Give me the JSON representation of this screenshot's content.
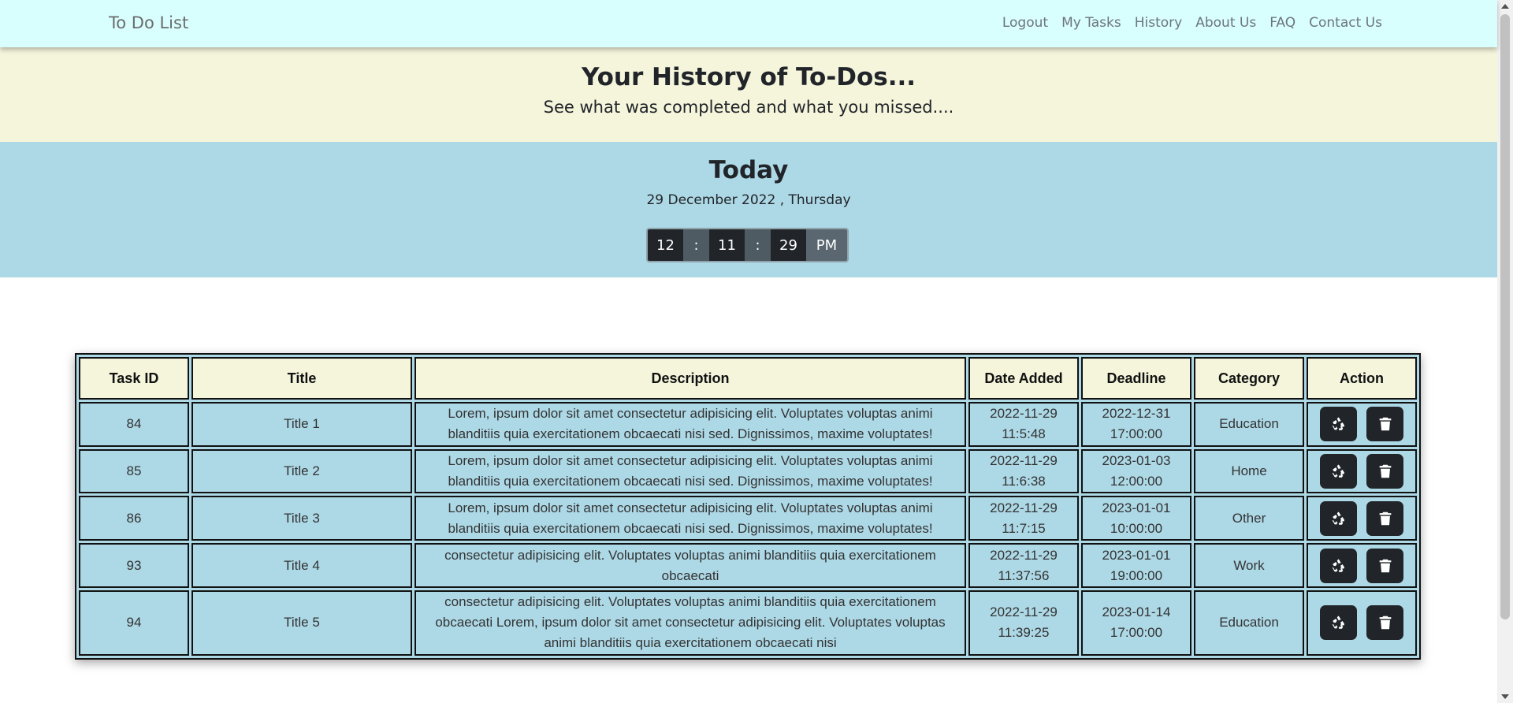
{
  "navbar": {
    "brand": "To Do List",
    "links": [
      "Logout",
      "My Tasks",
      "History",
      "About Us",
      "FAQ",
      "Contact Us"
    ]
  },
  "hero": {
    "title": "Your History of To-Dos...",
    "subtitle": "See what was completed and what you missed...."
  },
  "today": {
    "heading": "Today",
    "date": "29 December 2022 , Thursday",
    "clock": {
      "hours": "12",
      "minutes": "11",
      "seconds": "29",
      "separator": ":",
      "ampm": "PM"
    }
  },
  "table": {
    "headers": [
      "Task ID",
      "Title",
      "Description",
      "Date Added",
      "Deadline",
      "Category",
      "Action"
    ],
    "rows": [
      {
        "id": "84",
        "title": "Title 1",
        "description": "Lorem, ipsum dolor sit amet consectetur adipisicing elit. Voluptates voluptas animi blanditiis quia exercitationem obcaecati nisi sed. Dignissimos, maxime voluptates!",
        "date_added": [
          "2022-11-29",
          "11:5:48"
        ],
        "deadline": [
          "2022-12-31",
          "17:00:00"
        ],
        "category": "Education"
      },
      {
        "id": "85",
        "title": "Title 2",
        "description": "Lorem, ipsum dolor sit amet consectetur adipisicing elit. Voluptates voluptas animi blanditiis quia exercitationem obcaecati nisi sed. Dignissimos, maxime voluptates!",
        "date_added": [
          "2022-11-29",
          "11:6:38"
        ],
        "deadline": [
          "2023-01-03",
          "12:00:00"
        ],
        "category": "Home"
      },
      {
        "id": "86",
        "title": "Title 3",
        "description": "Lorem, ipsum dolor sit amet consectetur adipisicing elit. Voluptates voluptas animi blanditiis quia exercitationem obcaecati nisi sed. Dignissimos, maxime voluptates!",
        "date_added": [
          "2022-11-29",
          "11:7:15"
        ],
        "deadline": [
          "2023-01-01",
          "10:00:00"
        ],
        "category": "Other"
      },
      {
        "id": "93",
        "title": "Title 4",
        "description": "consectetur adipisicing elit. Voluptates voluptas animi blanditiis quia exercitationem obcaecati",
        "date_added": [
          "2022-11-29",
          "11:37:56"
        ],
        "deadline": [
          "2023-01-01",
          "19:00:00"
        ],
        "category": "Work"
      },
      {
        "id": "94",
        "title": "Title 5",
        "description": "consectetur adipisicing elit. Voluptates voluptas animi blanditiis quia exercitationem obcaecati Lorem, ipsum dolor sit amet consectetur adipisicing elit. Voluptates voluptas animi blanditiis quia exercitationem obcaecati nisi",
        "date_added": [
          "2022-11-29",
          "11:39:25"
        ],
        "deadline": [
          "2023-01-14",
          "17:00:00"
        ],
        "category": "Education"
      }
    ],
    "actions": {
      "restore_icon": "recycle-icon",
      "delete_icon": "trash-icon"
    }
  },
  "colors": {
    "navbar_bg": "#d9fefe",
    "hero_bg": "#f5f5dc",
    "today_bg": "#add8e6",
    "table_header_bg": "#f5f5dc",
    "table_cell_bg": "#add8e6",
    "button_dark": "#212529"
  }
}
